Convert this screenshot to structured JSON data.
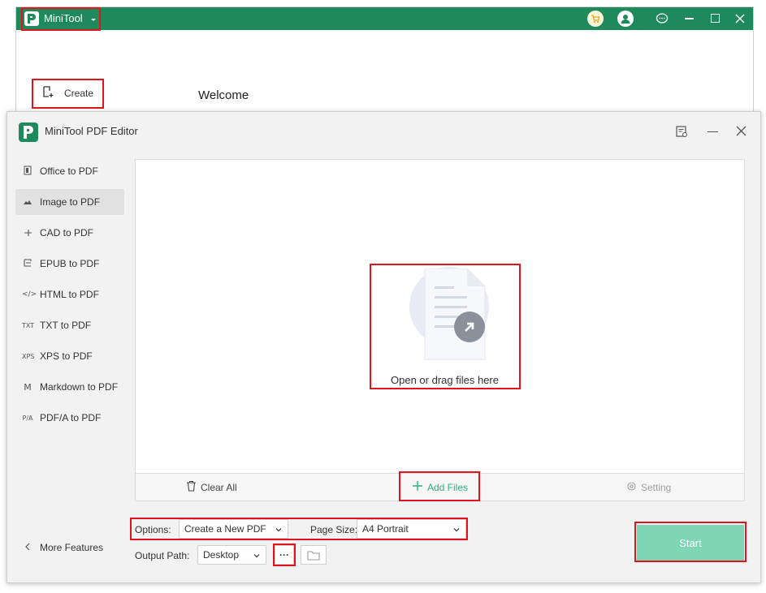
{
  "back_window": {
    "app_name": "MiniTool",
    "create_label": "Create",
    "welcome": "Welcome"
  },
  "front_window": {
    "title": "MiniTool PDF Editor",
    "sidebar": {
      "items": [
        {
          "icon": "office-icon",
          "label": "Office to PDF"
        },
        {
          "icon": "image-icon",
          "label": "Image to PDF",
          "active": true
        },
        {
          "icon": "cad-icon",
          "label": "CAD to PDF"
        },
        {
          "icon": "epub-icon",
          "label": "EPUB to PDF"
        },
        {
          "icon": "html-icon",
          "glyph": "</>",
          "label": "HTML to PDF"
        },
        {
          "icon": "txt-icon",
          "glyph": "TXT",
          "label": "TXT to PDF"
        },
        {
          "icon": "xps-icon",
          "glyph": "XPS",
          "label": "XPS to PDF"
        },
        {
          "icon": "markdown-icon",
          "glyph": "M",
          "label": "Markdown to PDF"
        },
        {
          "icon": "pdfa-icon",
          "glyph": "P/A",
          "label": "PDF/A to PDF"
        }
      ],
      "more_features": "More Features"
    },
    "dropzone": {
      "text": "Open or drag files here"
    },
    "actions": {
      "clear_all": "Clear All",
      "add_files": "Add Files",
      "setting": "Setting"
    },
    "options": {
      "options_label": "Options:",
      "options_value": "Create a New PDF",
      "page_size_label": "Page Size:",
      "page_size_value": "A4 Portrait",
      "output_path_label": "Output Path:",
      "output_path_value": "Desktop",
      "more_button": "···"
    },
    "start_label": "Start"
  },
  "colors": {
    "brand_green": "#1e8a5c",
    "accent_green": "#2ab27b",
    "start_button": "#7fd6b5",
    "highlight_red": "#e0141e"
  }
}
